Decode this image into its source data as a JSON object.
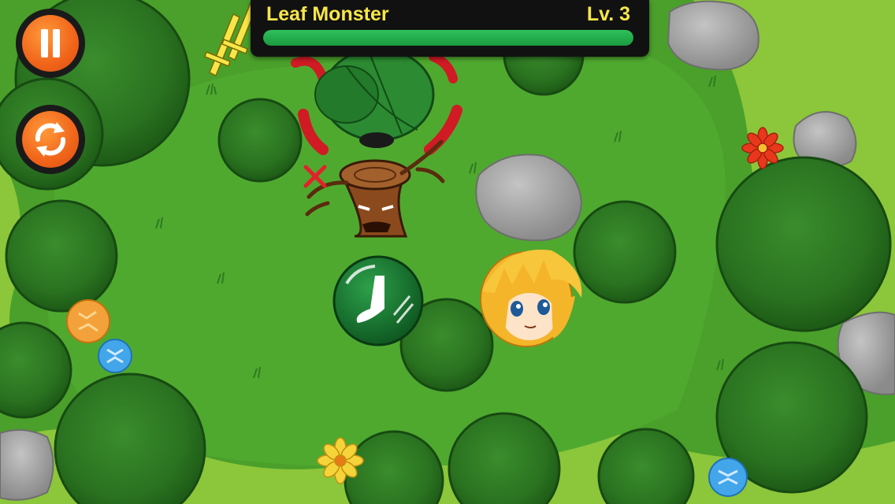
{
  "hud": {
    "enemy_name": "Leaf Monster",
    "enemy_level": "Lv. 3",
    "health_fraction": 1.0,
    "health_color": "#28b34f",
    "text_color": "#f7e64a"
  },
  "controls": {
    "pause_icon": "pause-icon",
    "restart_icon": "restart-icon",
    "button_color": "#f0641a"
  },
  "palette": {
    "grass": "#4a9a2a",
    "path": "#8fc63a",
    "bush_dark": "#1c5a16",
    "bush_mid": "#2e7d22",
    "rock": "#9a9a9a"
  }
}
